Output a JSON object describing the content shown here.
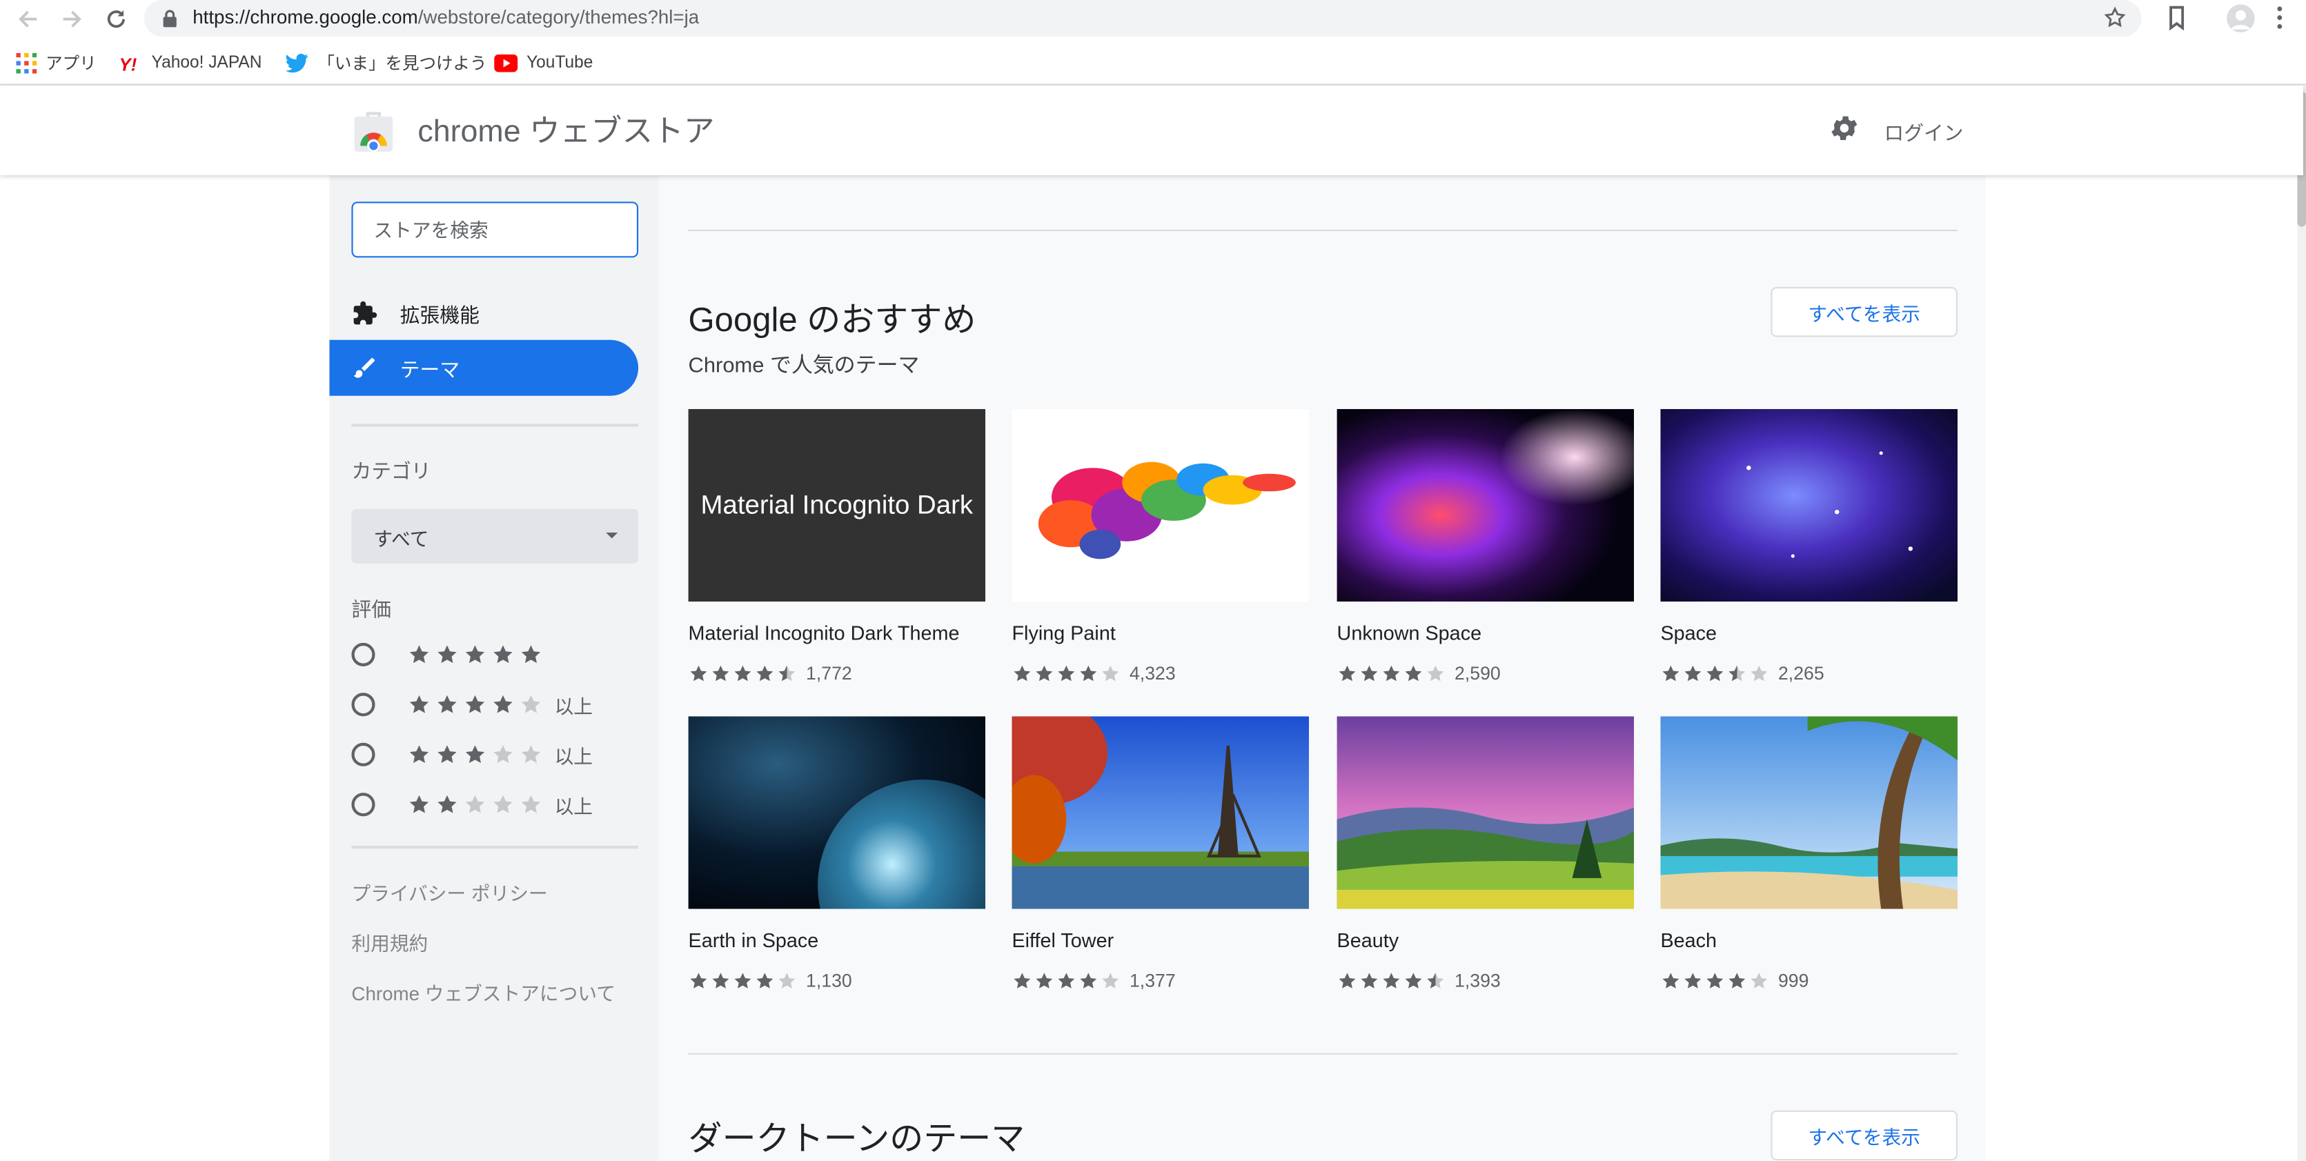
{
  "browser": {
    "url_host": "https://chrome.google.com",
    "url_path": "/webstore/category/themes?hl=ja",
    "bookmarks": [
      {
        "label": "アプリ"
      },
      {
        "label": "Yahoo! JAPAN"
      },
      {
        "label": "「いま」を見つけよう"
      },
      {
        "label": "YouTube"
      }
    ]
  },
  "header": {
    "title": "chrome ウェブストア",
    "login": "ログイン"
  },
  "sidebar": {
    "search_placeholder": "ストアを検索",
    "nav": [
      {
        "label": "拡張機能",
        "icon": "puzzle-icon"
      },
      {
        "label": "テーマ",
        "icon": "brush-icon",
        "active": true
      }
    ],
    "category_label": "カテゴリ",
    "category_value": "すべて",
    "rating_label": "評価",
    "ratings": [
      {
        "stars": 5,
        "suffix": ""
      },
      {
        "stars": 4,
        "suffix": "以上"
      },
      {
        "stars": 3,
        "suffix": "以上"
      },
      {
        "stars": 2,
        "suffix": "以上"
      }
    ],
    "footer": [
      "プライバシー ポリシー",
      "利用規約",
      "Chrome ウェブストアについて"
    ]
  },
  "main": {
    "section1": {
      "title": "Google のおすすめ",
      "subtitle": "Chrome で人気のテーマ",
      "view_all": "すべてを表示"
    },
    "section2": {
      "title": "ダークトーンのテーマ",
      "view_all": "すべてを表示"
    },
    "themes": [
      {
        "name": "Material Incognito Dark Theme",
        "thumb_text": "Material Incognito Dark",
        "rating": 4.5,
        "count": "1,772"
      },
      {
        "name": "Flying Paint",
        "rating": 4,
        "count": "4,323"
      },
      {
        "name": "Unknown Space",
        "rating": 4,
        "count": "2,590"
      },
      {
        "name": "Space",
        "rating": 3.5,
        "count": "2,265"
      },
      {
        "name": "Earth in Space",
        "rating": 4,
        "count": "1,130"
      },
      {
        "name": "Eiffel Tower",
        "rating": 4,
        "count": "1,377"
      },
      {
        "name": "Beauty",
        "rating": 4.5,
        "count": "1,393"
      },
      {
        "name": "Beach",
        "rating": 4,
        "count": "999"
      }
    ]
  },
  "colors": {
    "accent": "#1a73e8",
    "star_filled": "#5f6368",
    "star_empty": "#c6c9cc",
    "sidebar_bg": "#f1f3f4",
    "main_bg": "#f8f9fa"
  }
}
